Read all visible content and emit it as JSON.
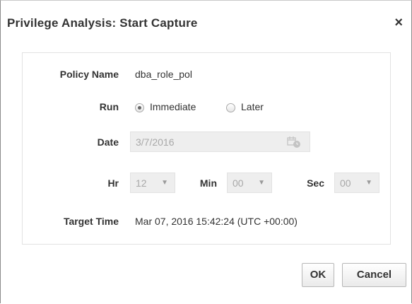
{
  "dialog": {
    "title": "Privilege Analysis: Start Capture",
    "close_symbol": "×"
  },
  "form": {
    "policy_name_label": "Policy Name",
    "policy_name_value": "dba_role_pol",
    "run_label": "Run",
    "run_options": [
      {
        "label": "Immediate",
        "selected": true
      },
      {
        "label": "Later",
        "selected": false
      }
    ],
    "date_label": "Date",
    "date_value": "3/7/2016",
    "date_icon": "calendar-clock-icon",
    "hr_label": "Hr",
    "hr_value": "12",
    "min_label": "Min",
    "min_value": "00",
    "sec_label": "Sec",
    "sec_value": "00",
    "dropdown_caret": "▼",
    "target_time_label": "Target Time",
    "target_time_value": "Mar 07, 2016 15:42:24 (UTC +00:00)"
  },
  "buttons": {
    "ok_label": "OK",
    "cancel_label": "Cancel"
  }
}
